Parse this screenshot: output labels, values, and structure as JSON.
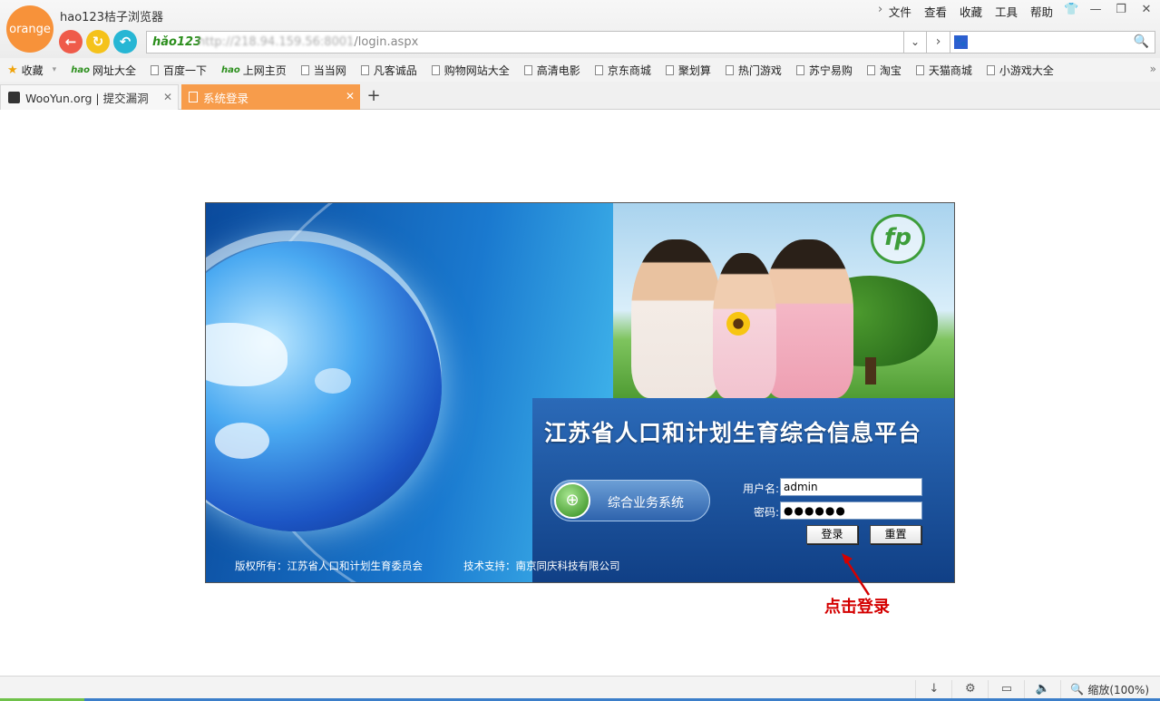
{
  "app": {
    "logo_text": "orange",
    "title": "hao123桔子浏览器",
    "menu": [
      "文件",
      "查看",
      "收藏",
      "工具",
      "帮助"
    ]
  },
  "address": {
    "brand": "hǎo123",
    "url_hidden": "http://218.94.159.56:8001",
    "url_visible": "/login.aspx"
  },
  "bookmarks": [
    {
      "label": "收藏",
      "icon": "star-icon"
    },
    {
      "label": "网址大全",
      "icon": "hao-icon"
    },
    {
      "label": "百度一下",
      "icon": "page-icon"
    },
    {
      "label": "上网主页",
      "icon": "hao-icon"
    },
    {
      "label": "当当网",
      "icon": "page-icon"
    },
    {
      "label": "凡客诚品",
      "icon": "page-icon"
    },
    {
      "label": "购物网站大全",
      "icon": "page-icon"
    },
    {
      "label": "高清电影",
      "icon": "page-icon"
    },
    {
      "label": "京东商城",
      "icon": "page-icon"
    },
    {
      "label": "聚划算",
      "icon": "page-icon"
    },
    {
      "label": "热门游戏",
      "icon": "page-icon"
    },
    {
      "label": "苏宁易购",
      "icon": "page-icon"
    },
    {
      "label": "淘宝",
      "icon": "page-icon"
    },
    {
      "label": "天猫商城",
      "icon": "page-icon"
    },
    {
      "label": "小游戏大全",
      "icon": "page-icon"
    }
  ],
  "tabs": [
    {
      "label": "WooYun.org | 提交漏洞",
      "active": false
    },
    {
      "label": "系统登录",
      "active": true
    }
  ],
  "login": {
    "platform_title": "江苏省人口和计划生育综合信息平台",
    "system_name": "综合业务系统",
    "username_label": "用户名:",
    "password_label": "密码:",
    "username_value": "admin",
    "password_value": "●●●●●●",
    "login_button": "登录",
    "reset_button": "重置",
    "copyright": "版权所有：江苏省人口和计划生育委员会",
    "tech_support": "技术支持：南京同庆科技有限公司"
  },
  "annotation": {
    "text": "点击登录",
    "color": "#d40000"
  },
  "status": {
    "zoom_label": "缩放(100%)"
  },
  "colors": {
    "active_tab": "#f79c4b",
    "logo": "#f7923a"
  }
}
